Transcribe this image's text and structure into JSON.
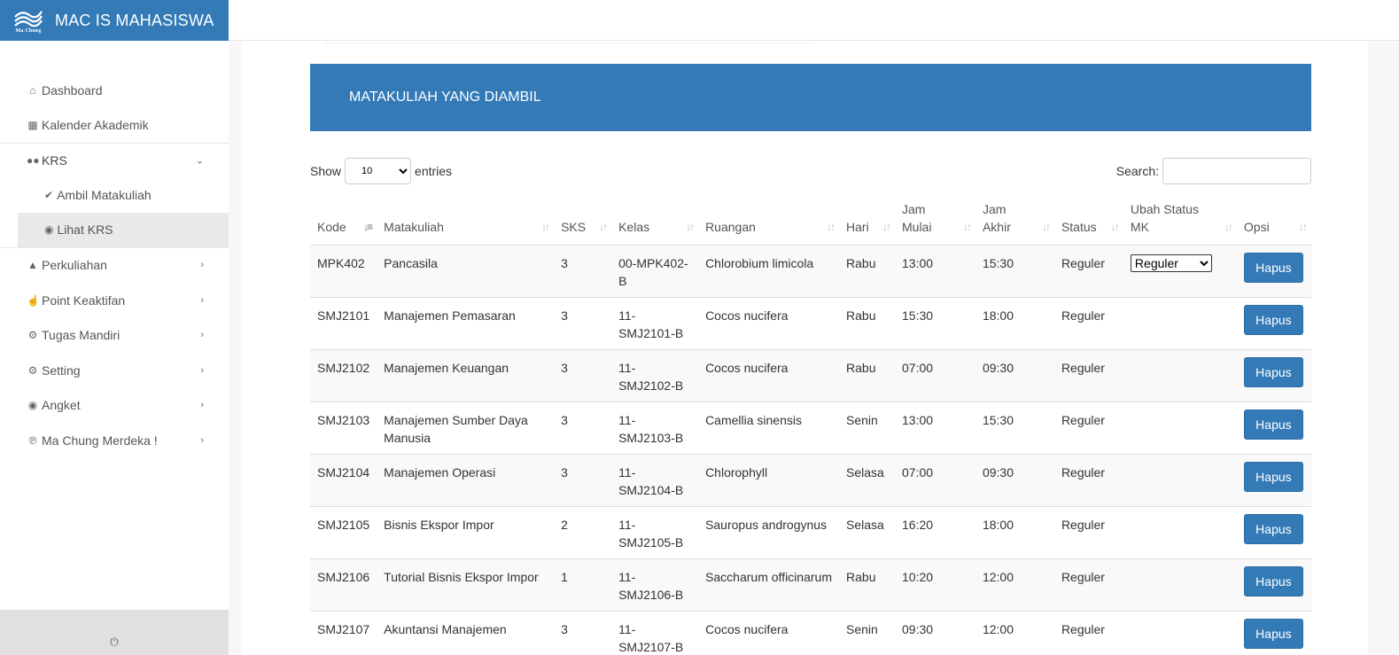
{
  "app": {
    "title": "MAC IS MAHASISWA",
    "logo_text": "Ma Chung"
  },
  "colors": {
    "primary": "#337ab7",
    "sidebar_active": "#e9e9e9"
  },
  "sidebar": {
    "items": [
      {
        "label": "Dashboard",
        "icon": "home-icon"
      },
      {
        "label": "Kalender Akademik",
        "icon": "calendar-icon"
      },
      {
        "label": "KRS",
        "icon": "glasses-icon",
        "expanded": true
      },
      {
        "label": "Perkuliahan",
        "icon": "graduation-cap-icon"
      },
      {
        "label": "Point Keaktifan",
        "icon": "thumbs-up-icon"
      },
      {
        "label": "Tugas Mandiri",
        "icon": "gear-icon"
      },
      {
        "label": "Setting",
        "icon": "gear-icon"
      },
      {
        "label": "Angket",
        "icon": "comment-icon"
      },
      {
        "label": "Ma Chung Merdeka !",
        "icon": "rss-icon"
      }
    ],
    "krs_sub": [
      {
        "label": "Ambil Matakuliah",
        "icon": "check-icon"
      },
      {
        "label": "Lihat KRS",
        "icon": "eye-icon",
        "active": true
      }
    ]
  },
  "main": {
    "banner_title": "MATAKULIAH YANG DIAMBIL",
    "show_label": "Show",
    "entries_label": "entries",
    "page_size": "10",
    "search_label": "Search:",
    "search_value": "",
    "columns": {
      "kode": "Kode",
      "matakuliah": "Matakuliah",
      "sks": "SKS",
      "kelas": "Kelas",
      "ruangan": "Ruangan",
      "hari": "Hari",
      "jam_mulai": "Jam Mulai",
      "jam_akhir": "Jam Akhir",
      "status": "Status",
      "ubah_status": "Ubah Status MK",
      "opsi": "Opsi"
    },
    "hapus_label": "Hapus",
    "status_option": "Reguler",
    "rows": [
      {
        "kode": "MPK402",
        "matakuliah": "Pancasila",
        "sks": "3",
        "kelas": "00-MPK402-B",
        "ruangan": "Chlorobium limicola",
        "hari": "Rabu",
        "jam_mulai": "13:00",
        "jam_akhir": "15:30",
        "status": "Reguler",
        "has_select": true
      },
      {
        "kode": "SMJ2101",
        "matakuliah": "Manajemen Pemasaran",
        "sks": "3",
        "kelas": "11-SMJ2101-B",
        "ruangan": "Cocos nucifera",
        "hari": "Rabu",
        "jam_mulai": "15:30",
        "jam_akhir": "18:00",
        "status": "Reguler"
      },
      {
        "kode": "SMJ2102",
        "matakuliah": "Manajemen Keuangan",
        "sks": "3",
        "kelas": "11-SMJ2102-B",
        "ruangan": "Cocos nucifera",
        "hari": "Rabu",
        "jam_mulai": "07:00",
        "jam_akhir": "09:30",
        "status": "Reguler"
      },
      {
        "kode": "SMJ2103",
        "matakuliah": "Manajemen Sumber Daya Manusia",
        "sks": "3",
        "kelas": "11-SMJ2103-B",
        "ruangan": "Camellia sinensis",
        "hari": "Senin",
        "jam_mulai": "13:00",
        "jam_akhir": "15:30",
        "status": "Reguler"
      },
      {
        "kode": "SMJ2104",
        "matakuliah": "Manajemen Operasi",
        "sks": "3",
        "kelas": "11-SMJ2104-B",
        "ruangan": "Chlorophyll",
        "hari": "Selasa",
        "jam_mulai": "07:00",
        "jam_akhir": "09:30",
        "status": "Reguler"
      },
      {
        "kode": "SMJ2105",
        "matakuliah": "Bisnis Ekspor Impor",
        "sks": "2",
        "kelas": "11-SMJ2105-B",
        "ruangan": "Sauropus androgynus",
        "hari": "Selasa",
        "jam_mulai": "16:20",
        "jam_akhir": "18:00",
        "status": "Reguler"
      },
      {
        "kode": "SMJ2106",
        "matakuliah": "Tutorial Bisnis Ekspor Impor",
        "sks": "1",
        "kelas": "11-SMJ2106-B",
        "ruangan": "Saccharum officinarum",
        "hari": "Rabu",
        "jam_mulai": "10:20",
        "jam_akhir": "12:00",
        "status": "Reguler"
      },
      {
        "kode": "SMJ2107",
        "matakuliah": "Akuntansi Manajemen",
        "sks": "3",
        "kelas": "11-SMJ2107-B",
        "ruangan": "Cocos nucifera",
        "hari": "Senin",
        "jam_mulai": "09:30",
        "jam_akhir": "12:00",
        "status": "Reguler"
      }
    ]
  }
}
